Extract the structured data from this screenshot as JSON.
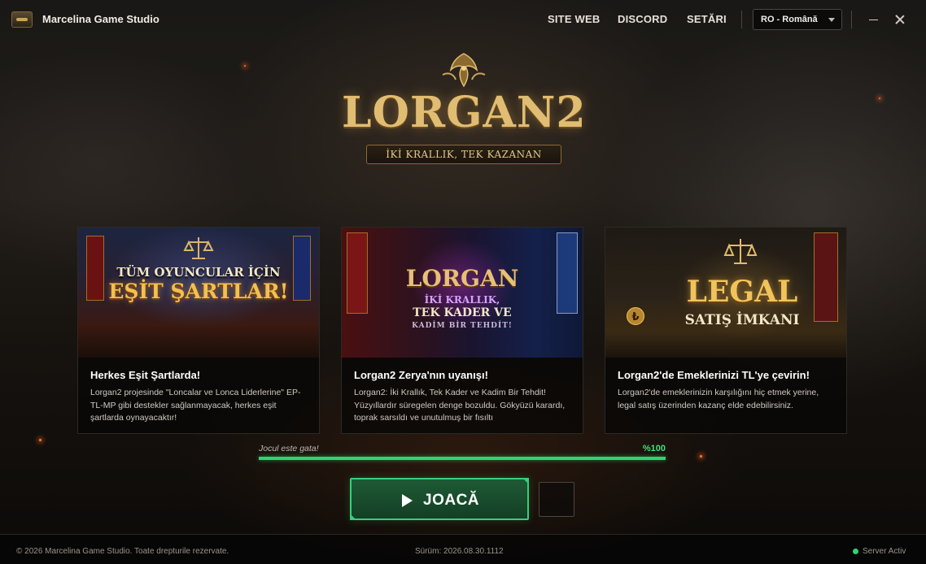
{
  "app": {
    "name": "Marcelina Game Studio"
  },
  "nav": {
    "items": [
      "SITE WEB",
      "DISCORD",
      "SETĂRI"
    ]
  },
  "language": {
    "selected": "RO - Română"
  },
  "logo": {
    "title": "LORGAN2",
    "subtitle": "İKİ KRALLIK, TEK KAZANAN"
  },
  "cards": [
    {
      "image_text_1": "TÜM OYUNCULAR İÇİN",
      "image_text_2": "EŞİT ŞARTLAR!",
      "title": "Herkes Eşit Şartlarda!",
      "text": "Lorgan2 projesinde \"Loncalar ve Lonca Liderlerine\" EP-TL-MP gibi destekler sağlanmayacak, herkes eşit şartlarda oynayacaktır!"
    },
    {
      "image_text_1": "LORGAN",
      "image_text_2": "İKİ KRALLIK,",
      "image_text_3": "TEK KADER VE",
      "image_text_4": "KADİM BİR TEHDİT!",
      "title": "Lorgan2 Zerya'nın uyanışı!",
      "text": "Lorgan2: İki Krallık, Tek Kader ve Kadim Bir Tehdit! Yüzyıllardır süregelen denge bozuldu. Gökyüzü karardı, toprak sarsıldı ve unutulmuş bir fısıltı"
    },
    {
      "image_text_1": "LEGAL",
      "image_text_2": "SATIŞ İMKANI",
      "title": "Lorgan2'de Emeklerinizi TL'ye çevirin!",
      "text": "Lorgan2'de emeklerinizin karşılığını hiç etmek yerine, legal satış üzerinden kazanç elde edebilirsiniz."
    }
  ],
  "progress": {
    "status": "Jocul este gata!",
    "percent_label": "%100",
    "value": 1.0
  },
  "play": {
    "label": "JOACĂ"
  },
  "footer": {
    "copyright": "© 2026 Marcelina Game Studio. Toate drepturile rezervate.",
    "version": "Sürüm: 2026.08.30.1112",
    "server_status": "Server Activ"
  },
  "colors": {
    "accent": "#2fd472",
    "gold": "#e0bd72",
    "background": "#0b0a09"
  }
}
